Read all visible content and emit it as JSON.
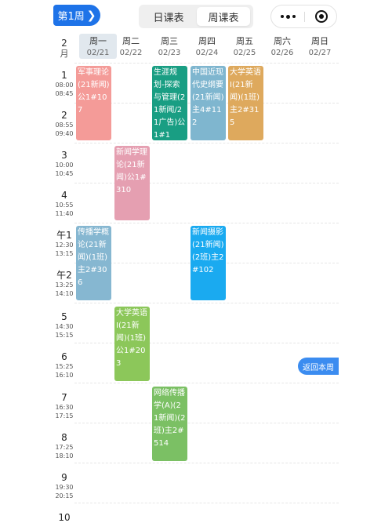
{
  "topbar": {
    "week_label": "第1周",
    "week_chevron": "❯",
    "tab_day": "日课表",
    "tab_week": "周课表"
  },
  "header": {
    "month_num": "2",
    "month_unit": "月",
    "days": [
      {
        "weekday": "周一",
        "date": "02/21",
        "active": true
      },
      {
        "weekday": "周二",
        "date": "02/22",
        "active": false
      },
      {
        "weekday": "周三",
        "date": "02/23",
        "active": false
      },
      {
        "weekday": "周四",
        "date": "02/24",
        "active": false
      },
      {
        "weekday": "周五",
        "date": "02/25",
        "active": false
      },
      {
        "weekday": "周六",
        "date": "02/26",
        "active": false
      },
      {
        "weekday": "周日",
        "date": "02/27",
        "active": false
      }
    ]
  },
  "periods": [
    {
      "label": "1",
      "start": "08:00",
      "end": "08:45"
    },
    {
      "label": "2",
      "start": "08:55",
      "end": "09:40"
    },
    {
      "label": "3",
      "start": "10:00",
      "end": "10:45"
    },
    {
      "label": "4",
      "start": "10:55",
      "end": "11:40"
    },
    {
      "label": "午1",
      "start": "12:30",
      "end": "13:15"
    },
    {
      "label": "午2",
      "start": "13:25",
      "end": "14:10"
    },
    {
      "label": "5",
      "start": "14:30",
      "end": "15:15"
    },
    {
      "label": "6",
      "start": "15:25",
      "end": "16:10"
    },
    {
      "label": "7",
      "start": "16:30",
      "end": "17:15"
    },
    {
      "label": "8",
      "start": "17:25",
      "end": "18:10"
    },
    {
      "label": "9",
      "start": "19:30",
      "end": "20:15"
    },
    {
      "label": "10",
      "start": "",
      "end": ""
    }
  ],
  "courses": [
    {
      "text": "军事理论(21新闻)公1#107",
      "color": "#f49b98"
    },
    {
      "text": "生涯规划-探索与管理(21新闻/21广告)公1#1",
      "color": "#199e83"
    },
    {
      "text": "中国近现代史纲要(21新闻)主4#112",
      "color": "#7fb6cf"
    },
    {
      "text": "大学英语Ⅰ(21新闻)(1班)主2#315",
      "color": "#dea95d"
    },
    {
      "text": "新闻学理论(21新闻)公1#310",
      "color": "#e59fb1"
    },
    {
      "text": "传播学概论(21新闻)(1班)主2#306",
      "color": "#86b7d1"
    },
    {
      "text": "新闻摄影(21新闻)(2班)主2#102",
      "color": "#1aaaf0"
    },
    {
      "text": "大学英语Ⅰ(21新闻)(1班)公1#203",
      "color": "#8cc75a"
    },
    {
      "text": "网络传播学(A)(21新闻)(2班)主2#514",
      "color": "#7bc064"
    }
  ],
  "return_label": "返回本周"
}
